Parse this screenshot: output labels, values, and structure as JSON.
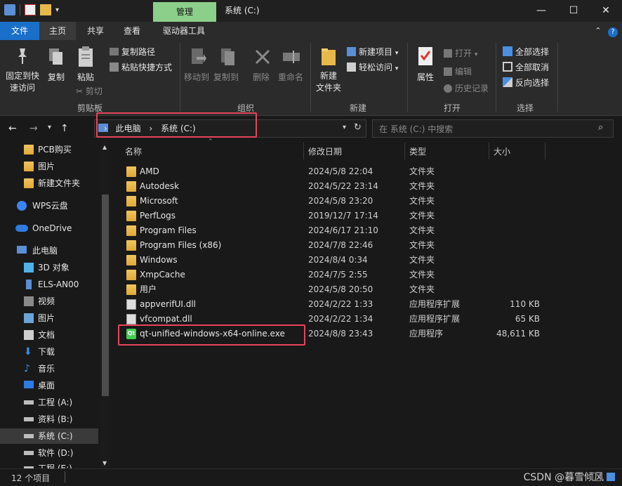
{
  "titlebar": {
    "context_tab": "管理",
    "window_title": "系统 (C:)",
    "minimize": "—",
    "maximize": "☐",
    "close": "✕"
  },
  "menu_tabs": [
    "文件",
    "主页",
    "共享",
    "查看",
    "驱动器工具"
  ],
  "ribbon": {
    "clipboard": {
      "pin_quick": [
        "固定到快",
        "速访问"
      ],
      "copy": "复制",
      "paste": "粘贴",
      "copy_path": "复制路径",
      "paste_shortcut": "粘贴快捷方式",
      "cut": "剪切",
      "group": "剪贴板"
    },
    "organize": {
      "move_to": "移动到",
      "copy_to": "复制到",
      "delete": "删除",
      "rename": "重命名",
      "group": "组织"
    },
    "new": {
      "new_folder": [
        "新建",
        "文件夹"
      ],
      "new_item": "新建项目",
      "easy_access": "轻松访问",
      "group": "新建"
    },
    "open": {
      "properties": "属性",
      "open": "打开",
      "edit": "编辑",
      "history": "历史记录",
      "group": "打开"
    },
    "select": {
      "select_all": "全部选择",
      "select_none": "全部取消",
      "invert": "反向选择",
      "group": "选择"
    }
  },
  "address": {
    "crumbs": [
      "此电脑",
      "系统 (C:)"
    ],
    "search_placeholder": "在 系统 (C:) 中搜索"
  },
  "nav": {
    "items": [
      {
        "label": "PCB购买",
        "icon": "folder-icon"
      },
      {
        "label": "图片",
        "icon": "folder-icon"
      },
      {
        "label": "新建文件夹",
        "icon": "folder-icon"
      },
      {
        "label": "WPS云盘",
        "icon": "cloud-icon"
      },
      {
        "label": "OneDrive",
        "icon": "onedrive-icon"
      },
      {
        "label": "此电脑",
        "icon": "computer-icon"
      },
      {
        "label": "3D 对象",
        "icon": "cube-icon"
      },
      {
        "label": "ELS-AN00",
        "icon": "phone-icon"
      },
      {
        "label": "视频",
        "icon": "video-icon"
      },
      {
        "label": "图片",
        "icon": "pictures-icon"
      },
      {
        "label": "文档",
        "icon": "documents-icon"
      },
      {
        "label": "下载",
        "icon": "download-icon"
      },
      {
        "label": "音乐",
        "icon": "music-icon"
      },
      {
        "label": "桌面",
        "icon": "desktop-icon"
      },
      {
        "label": "工程 (A:)",
        "icon": "drive-icon"
      },
      {
        "label": "资料 (B:)",
        "icon": "drive-icon"
      },
      {
        "label": "系统 (C:)",
        "icon": "drive-icon"
      },
      {
        "label": "软件 (D:)",
        "icon": "drive-icon"
      },
      {
        "label": "工程 (E:)",
        "icon": "drive-icon"
      }
    ]
  },
  "columns": [
    "名称",
    "修改日期",
    "类型",
    "大小"
  ],
  "files": [
    {
      "name": "AMD",
      "date": "2024/5/8 22:04",
      "type": "文件夹",
      "size": "",
      "icon": "folder-icon"
    },
    {
      "name": "Autodesk",
      "date": "2024/5/22 23:14",
      "type": "文件夹",
      "size": "",
      "icon": "folder-icon"
    },
    {
      "name": "Microsoft",
      "date": "2024/5/8 23:20",
      "type": "文件夹",
      "size": "",
      "icon": "folder-icon"
    },
    {
      "name": "PerfLogs",
      "date": "2019/12/7 17:14",
      "type": "文件夹",
      "size": "",
      "icon": "folder-icon"
    },
    {
      "name": "Program Files",
      "date": "2024/6/17 21:10",
      "type": "文件夹",
      "size": "",
      "icon": "folder-icon"
    },
    {
      "name": "Program Files (x86)",
      "date": "2024/7/8 22:46",
      "type": "文件夹",
      "size": "",
      "icon": "folder-icon"
    },
    {
      "name": "Windows",
      "date": "2024/8/4 0:34",
      "type": "文件夹",
      "size": "",
      "icon": "folder-icon"
    },
    {
      "name": "XmpCache",
      "date": "2024/7/5 2:55",
      "type": "文件夹",
      "size": "",
      "icon": "folder-icon"
    },
    {
      "name": "用户",
      "date": "2024/5/8 20:50",
      "type": "文件夹",
      "size": "",
      "icon": "folder-icon"
    },
    {
      "name": "appverifUI.dll",
      "date": "2024/2/22 1:33",
      "type": "应用程序扩展",
      "size": "110 KB",
      "icon": "dll-icon"
    },
    {
      "name": "vfcompat.dll",
      "date": "2024/2/22 1:34",
      "type": "应用程序扩展",
      "size": "65 KB",
      "icon": "dll-icon"
    },
    {
      "name": "qt-unified-windows-x64-online.exe",
      "date": "2024/8/8 23:43",
      "type": "应用程序",
      "size": "48,611 KB",
      "icon": "qt-icon"
    }
  ],
  "exe_icon_text": "Qt",
  "status": {
    "count": "12 个项目"
  },
  "watermark": "CSDN @暮雪倾风"
}
